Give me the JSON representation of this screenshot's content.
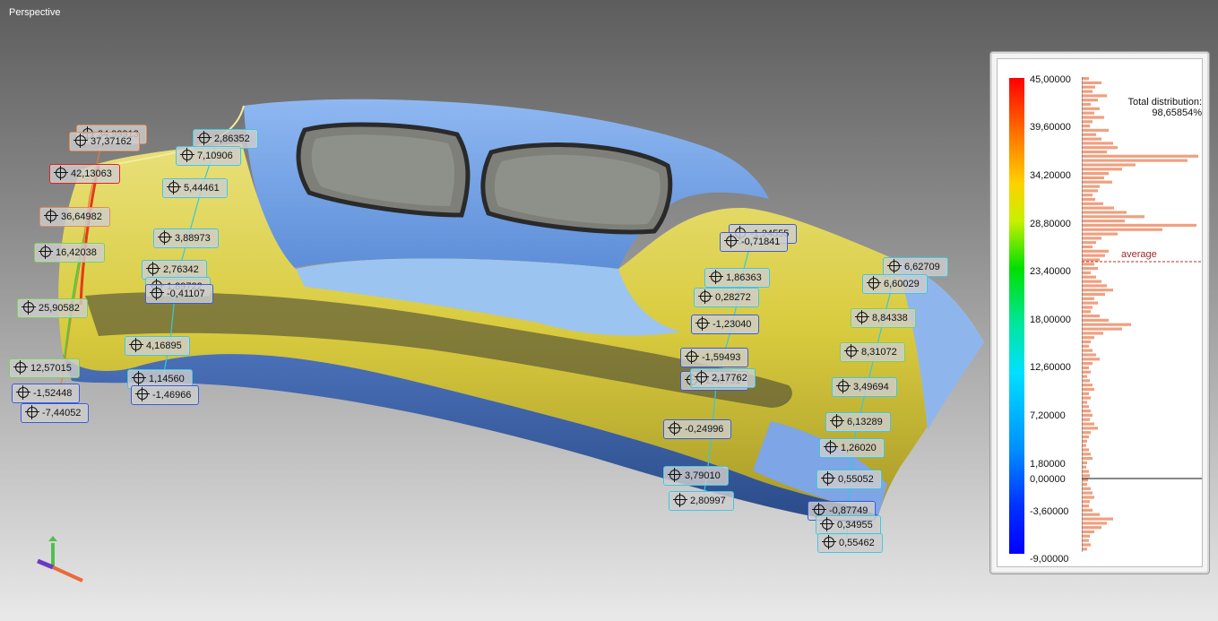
{
  "viewport": {
    "label": "Perspective"
  },
  "legend": {
    "ticks": [
      "45,00000",
      "39,60000",
      "34,20000",
      "28,80000",
      "23,40000",
      "18,00000",
      "12,60000",
      "7,20000",
      "1,80000",
      "0,00000",
      "-3,60000",
      "-9,00000"
    ],
    "total_distribution_title": "Total distribution:",
    "total_distribution_value": "98,65854%",
    "average_label": "average",
    "colors": {
      "max": "#ff0000",
      "high": "#ff8800",
      "mid_high": "#ffd000",
      "mid": "#00e000",
      "low": "#00e0ff",
      "min": "#0000ff",
      "histogram": "#f0a080",
      "average_line": "#b03030"
    }
  },
  "annotations": [
    {
      "value": "34,99913",
      "tone": "warm"
    },
    {
      "value": "37,37162",
      "tone": "warm"
    },
    {
      "value": "42,13063",
      "tone": "hot"
    },
    {
      "value": "36,64982",
      "tone": "warm"
    },
    {
      "value": "16,42038",
      "tone": "green"
    },
    {
      "value": "25,90582",
      "tone": "green"
    },
    {
      "value": "12,57015",
      "tone": "green"
    },
    {
      "value": "-1,52448",
      "tone": "blue"
    },
    {
      "value": "-7,44052",
      "tone": "blue"
    },
    {
      "value": "2,86352",
      "tone": "cyan"
    },
    {
      "value": "7,10906",
      "tone": "cyan"
    },
    {
      "value": "5,44461",
      "tone": "cyan"
    },
    {
      "value": "3,88973",
      "tone": "cyan"
    },
    {
      "value": "2,76342",
      "tone": "cyan"
    },
    {
      "value": "1,89722",
      "tone": "cyan"
    },
    {
      "value": "-0,41107",
      "tone": "blue"
    },
    {
      "value": "4,16895",
      "tone": "cyan"
    },
    {
      "value": "1,14560",
      "tone": "cyan"
    },
    {
      "value": "-1,46966",
      "tone": "blue"
    },
    {
      "value": "-1,24555",
      "tone": "blue"
    },
    {
      "value": "-0,71841",
      "tone": "blue"
    },
    {
      "value": "1,86363",
      "tone": "cyan"
    },
    {
      "value": "0,28272",
      "tone": "cyan"
    },
    {
      "value": "-1,23040",
      "tone": "blue"
    },
    {
      "value": "-1,59493",
      "tone": "blue"
    },
    {
      "value": "-1,49731",
      "tone": "blue"
    },
    {
      "value": "2,17762",
      "tone": "cyan"
    },
    {
      "value": "-0,24996",
      "tone": "blue"
    },
    {
      "value": "3,79010",
      "tone": "cyan"
    },
    {
      "value": "2,80997",
      "tone": "cyan"
    },
    {
      "value": "6,62709",
      "tone": "cyan"
    },
    {
      "value": "6,60029",
      "tone": "cyan"
    },
    {
      "value": "8,84338",
      "tone": "green"
    },
    {
      "value": "8,31072",
      "tone": "green"
    },
    {
      "value": "3,49694",
      "tone": "cyan"
    },
    {
      "value": "6,13289",
      "tone": "cyan"
    },
    {
      "value": "1,26020",
      "tone": "cyan"
    },
    {
      "value": "0,55052",
      "tone": "cyan"
    },
    {
      "value": "-0,87749",
      "tone": "blue"
    },
    {
      "value": "0,34955",
      "tone": "cyan"
    },
    {
      "value": "0,55462",
      "tone": "cyan"
    }
  ],
  "tone_colors": {
    "hot": "#e02020",
    "warm": "#e08a5a",
    "green": "#7ccf5a",
    "cyan": "#3fc6e0",
    "blue": "#3a5ad8"
  }
}
